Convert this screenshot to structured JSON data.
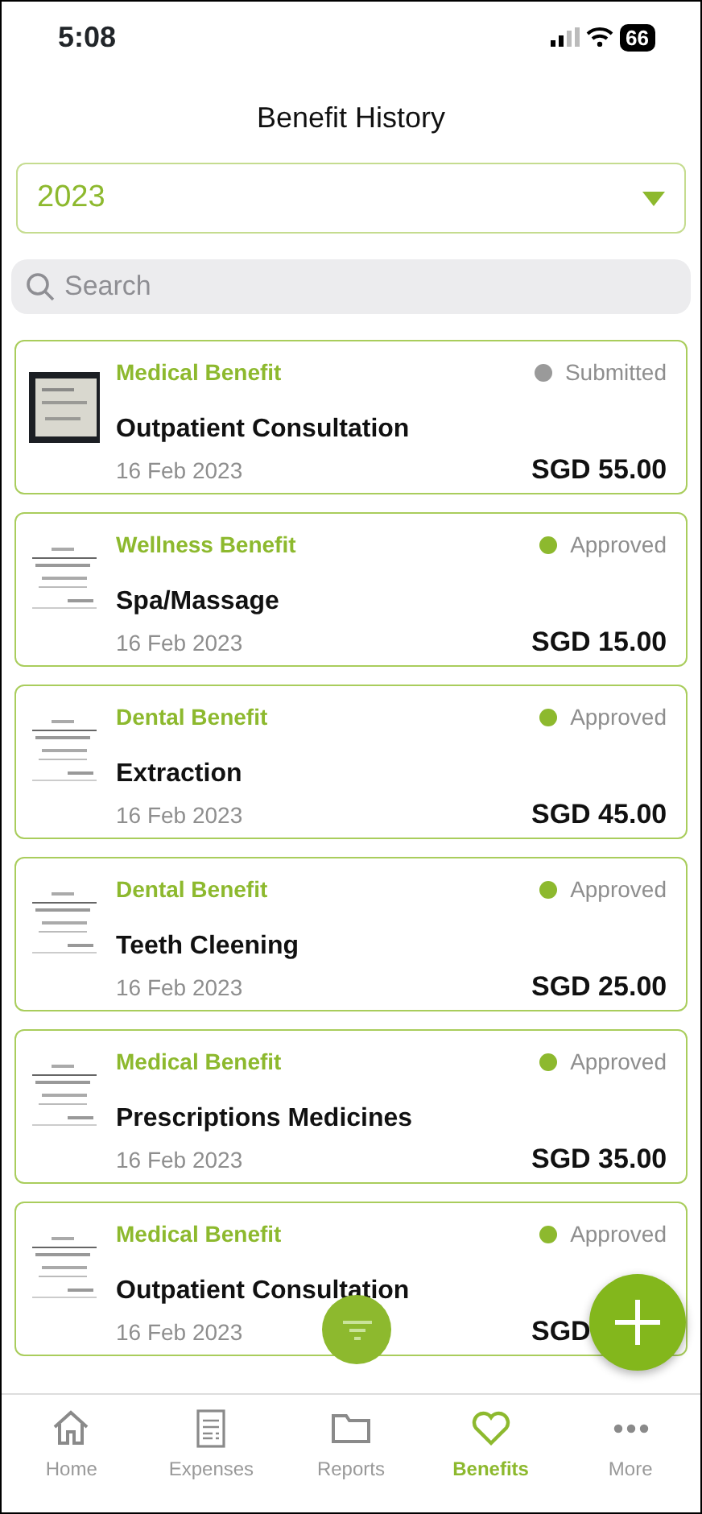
{
  "status_bar": {
    "time": "5:08",
    "battery": "66"
  },
  "header": {
    "title": "Benefit History"
  },
  "year_select": {
    "value": "2023"
  },
  "search": {
    "placeholder": "Search"
  },
  "claims": [
    {
      "category": "Medical Benefit",
      "status": "Submitted",
      "color": "#9a9a9a",
      "title": "Outpatient Consultation",
      "date": "16 Feb 2023",
      "amount": "SGD 55.00"
    },
    {
      "category": "Wellness Benefit",
      "status": "Approved",
      "color": "#8db92e",
      "title": "Spa/Massage",
      "date": "16 Feb 2023",
      "amount": "SGD 15.00"
    },
    {
      "category": "Dental Benefit",
      "status": "Approved",
      "color": "#8db92e",
      "title": "Extraction",
      "date": "16 Feb 2023",
      "amount": "SGD 45.00"
    },
    {
      "category": "Dental Benefit",
      "status": "Approved",
      "color": "#8db92e",
      "title": "Teeth Cleening",
      "date": "16 Feb 2023",
      "amount": "SGD 25.00"
    },
    {
      "category": "Medical Benefit",
      "status": "Approved",
      "color": "#8db92e",
      "title": "Prescriptions Medicines",
      "date": "16 Feb 2023",
      "amount": "SGD 35.00"
    },
    {
      "category": "Medical Benefit",
      "status": "Approved",
      "color": "#8db92e",
      "title": "Outpatient Consultation",
      "date": "16 Feb 2023",
      "amount": "SGD"
    }
  ],
  "tab_bar": [
    {
      "kind": "home",
      "label": "Home",
      "selected": false
    },
    {
      "kind": "expenses",
      "label": "Expenses",
      "selected": false
    },
    {
      "kind": "reports",
      "label": "Reports",
      "selected": false
    },
    {
      "kind": "benefits",
      "label": "Benefits",
      "selected": true
    },
    {
      "kind": "more",
      "label": "More",
      "selected": false
    }
  ]
}
